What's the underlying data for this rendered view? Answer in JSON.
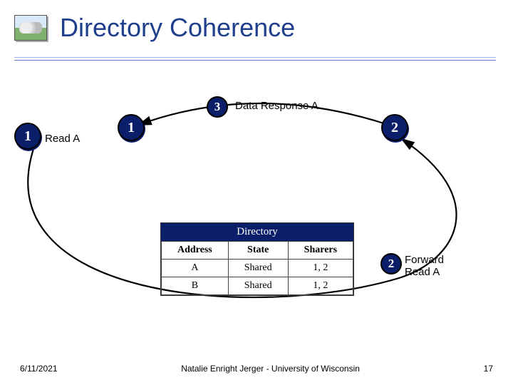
{
  "title": "Directory Coherence",
  "nodes": {
    "n1": "1",
    "n2": "1",
    "n3": "2"
  },
  "steps": {
    "s3": "3",
    "s2": "2"
  },
  "labels": {
    "readA": "Read A",
    "dataResp": "Data Response A",
    "fwd1": "Forward",
    "fwd2": "Read A"
  },
  "directory": {
    "title": "Directory",
    "cols": [
      "Address",
      "State",
      "Sharers"
    ],
    "rows": [
      [
        "A",
        "Shared",
        "1, 2"
      ],
      [
        "B",
        "Shared",
        "1, 2"
      ]
    ]
  },
  "footer": {
    "date": "6/11/2021",
    "author": "Natalie Enright Jerger - University of Wisconsin",
    "slide": "17"
  }
}
